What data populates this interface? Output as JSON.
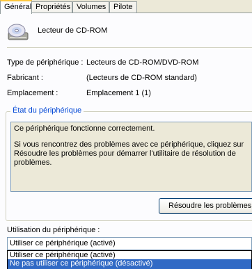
{
  "tabs": [
    "Général",
    "Propriétés",
    "Volumes",
    "Pilote"
  ],
  "device": {
    "name": "Lecteur de CD-ROM",
    "icon": "cd-drive-icon"
  },
  "info": {
    "type_label": "Type de périphérique :",
    "type_value": "Lecteurs de CD-ROM/DVD-ROM",
    "maker_label": "Fabricant :",
    "maker_value": "(Lecteurs de CD-ROM standard)",
    "location_label": "Emplacement :",
    "location_value": "Emplacement 1 (1)"
  },
  "status": {
    "group_title": "État du périphérique",
    "line1": "Ce périphérique fonctionne correctement.",
    "line2": "Si vous rencontrez des problèmes avec ce périphérique, cliquez sur Résoudre les problèmes pour démarrer l'utilitaire de résolution de problèmes."
  },
  "troubleshoot_button": "Résoudre les problèmes...",
  "usage": {
    "label": "Utilisation du périphérique :",
    "selected": "Utiliser ce périphérique (activé)",
    "options": [
      "Utiliser ce périphérique (activé)",
      "Ne pas utiliser ce périphérique (désactivé)"
    ]
  },
  "colors": {
    "accent": "#316AC5",
    "group_title": "#0046D5",
    "tab_highlight": "#FFC83C"
  }
}
